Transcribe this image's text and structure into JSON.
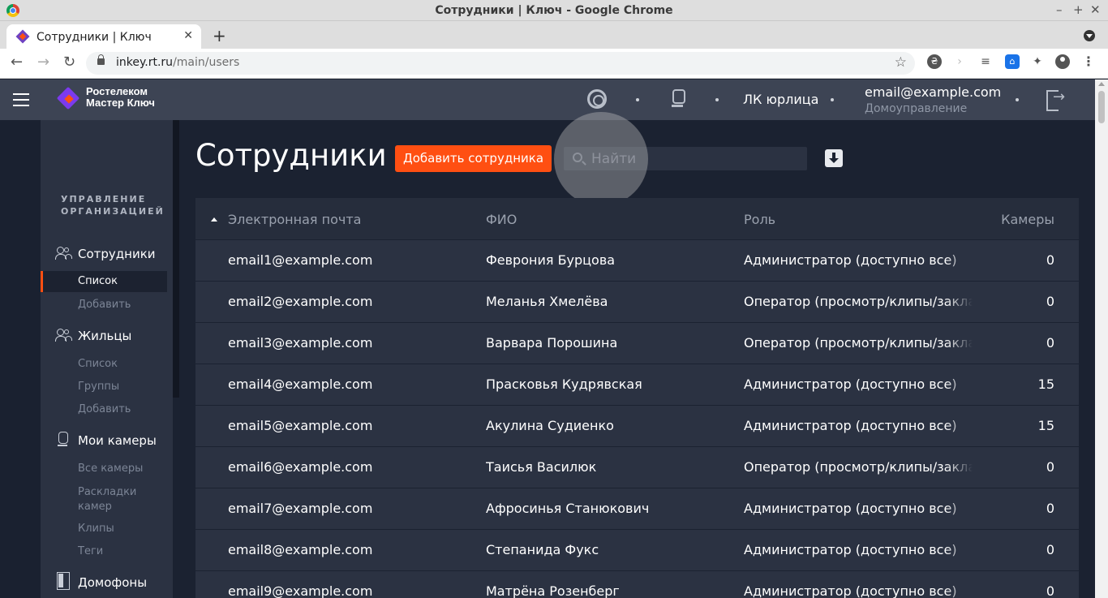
{
  "window": {
    "title": "Сотрудники | Ключ - Google Chrome",
    "controls": [
      "–",
      "+",
      "✕"
    ]
  },
  "browser": {
    "tab_title": "Сотрудники | Ключ",
    "tab_close": "✕",
    "new_tab": "+",
    "url_host": "inkey.rt.ru",
    "url_path": "/main/users",
    "back": "←",
    "forward": "→",
    "reload": "↻",
    "star": "☆"
  },
  "header": {
    "logo_line1": "Ростелеком",
    "logo_line2": "Мастер Ключ",
    "lk_link": "ЛК юрлица",
    "user_email": "email@example.com",
    "user_org": "Домоуправление"
  },
  "sidebar": {
    "heading_line1": "УПРАВЛЕНИЕ",
    "heading_line2": "ОРГАНИЗАЦИЕЙ",
    "employees": {
      "label": "Сотрудники",
      "items": [
        "Список",
        "Добавить"
      ]
    },
    "residents": {
      "label": "Жильцы",
      "items": [
        "Список",
        "Группы",
        "Добавить"
      ]
    },
    "cameras": {
      "label": "Мои камеры",
      "items": [
        "Все камеры",
        "Раскладки",
        "камер",
        "Клипы",
        "Теги"
      ]
    },
    "intercoms": {
      "label": "Домофоны"
    }
  },
  "main": {
    "title": "Сотрудники",
    "add_button": "Добавить сотрудника",
    "search_placeholder": "Найти",
    "columns": [
      "Электронная почта",
      "ФИО",
      "Роль",
      "Камеры"
    ],
    "rows": [
      {
        "email": "email1@example.com",
        "name": "Феврония Бурцова",
        "role": "Администратор (доступно все)",
        "cameras": "0"
      },
      {
        "email": "email2@example.com",
        "name": "Меланья Хмелёва",
        "role": "Оператор (просмотр/клипы/закладки)",
        "cameras": "0"
      },
      {
        "email": "email3@example.com",
        "name": "Варвара Порошина",
        "role": "Оператор (просмотр/клипы/закладки)",
        "cameras": "0"
      },
      {
        "email": "email4@example.com",
        "name": "Прасковья Кудрявская",
        "role": "Администратор (доступно все)",
        "cameras": "15"
      },
      {
        "email": "email5@example.com",
        "name": "Акулина Судиенко",
        "role": "Администратор (доступно все)",
        "cameras": "15"
      },
      {
        "email": "email6@example.com",
        "name": "Таисья Василюк",
        "role": "Оператор (просмотр/клипы/закладки)",
        "cameras": "0"
      },
      {
        "email": "email7@example.com",
        "name": "Афросинья Станюкович",
        "role": "Администратор (доступно все)",
        "cameras": "0"
      },
      {
        "email": "email8@example.com",
        "name": "Степанида Фукс",
        "role": "Администратор (доступно все)",
        "cameras": "0"
      },
      {
        "email": "email9@example.com",
        "name": "Матрёна Розенберг",
        "role": "Администратор (доступно все)",
        "cameras": "0"
      }
    ]
  },
  "colors": {
    "accent": "#ff4f12",
    "header_bg": "#3d4454",
    "sidebar_bg": "#2b3242",
    "main_bg": "#1b2231"
  }
}
